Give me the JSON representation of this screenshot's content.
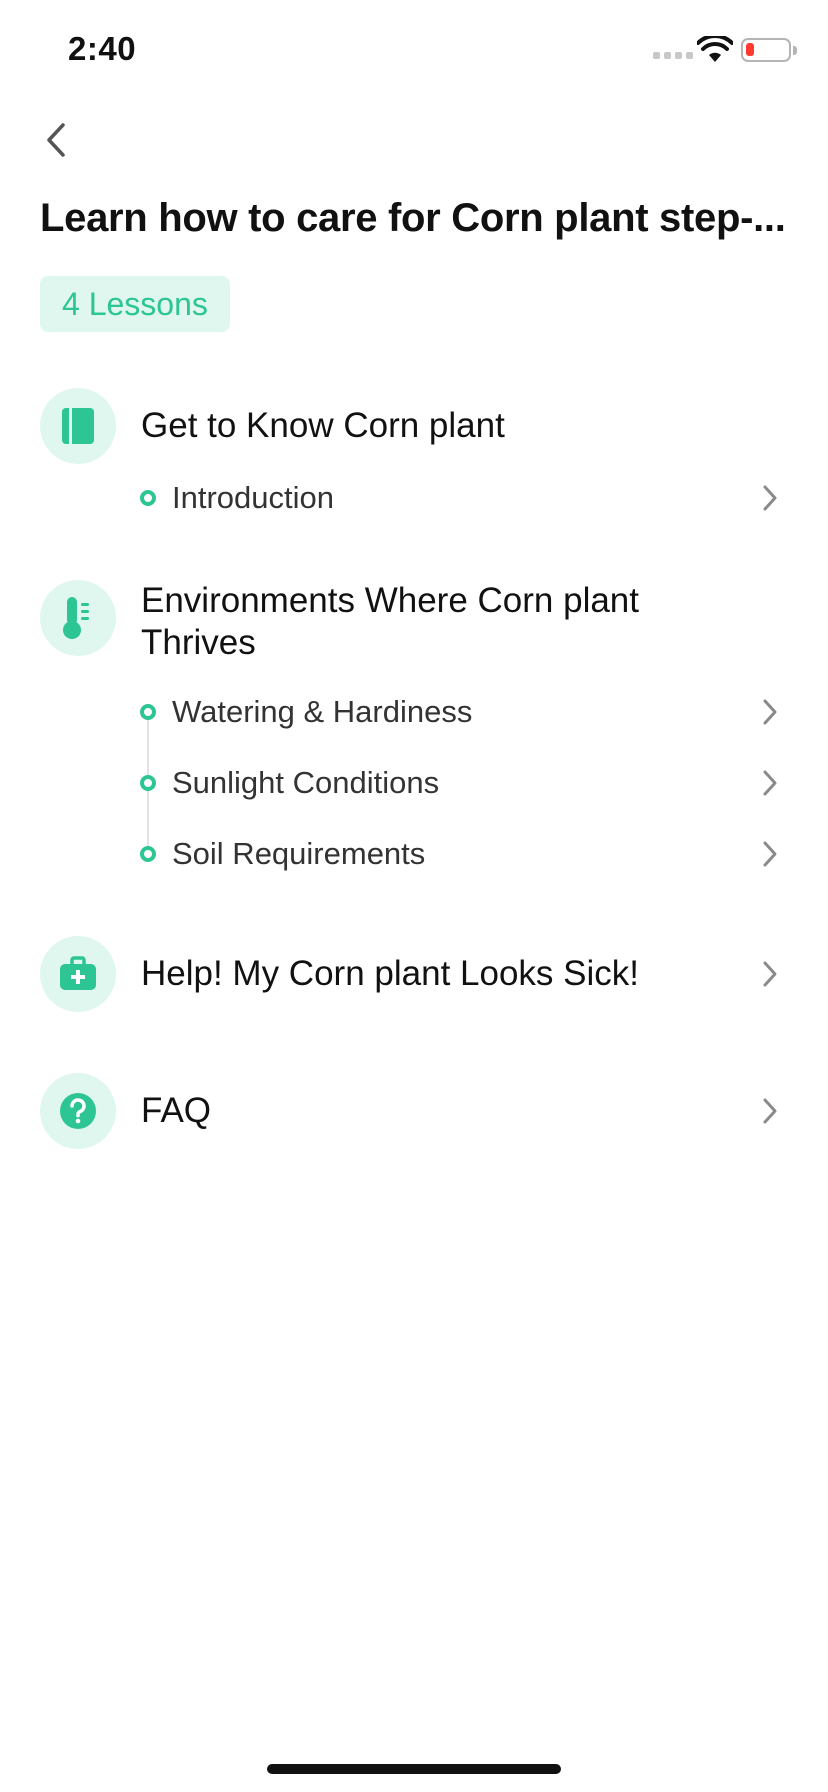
{
  "status_bar": {
    "time": "2:40"
  },
  "header": {
    "title": "Learn how to care for Corn plant step-...",
    "badge": "4 Lessons"
  },
  "sections": [
    {
      "title": "Get to Know Corn plant",
      "icon": "book-icon",
      "items": [
        {
          "label": "Introduction"
        }
      ]
    },
    {
      "title": "Environments Where Corn plant Thrives",
      "icon": "thermometer-icon",
      "items": [
        {
          "label": "Watering & Hardiness"
        },
        {
          "label": "Sunlight Conditions"
        },
        {
          "label": "Soil Requirements"
        }
      ]
    },
    {
      "title": "Help! My Corn plant Looks Sick!",
      "icon": "first-aid-kit-icon",
      "items": []
    },
    {
      "title": "FAQ",
      "icon": "question-icon",
      "items": []
    }
  ],
  "colors": {
    "accent": "#2cc593",
    "accent_light": "#dff7ee",
    "battery_low": "#ff3b30"
  }
}
